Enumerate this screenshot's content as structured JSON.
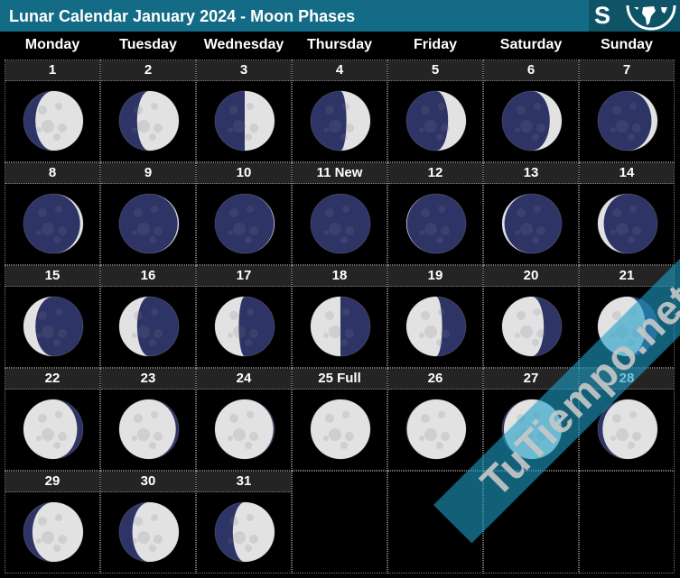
{
  "header": {
    "title": "Lunar Calendar January 2024 - Moon Phases",
    "hemisphere_label": "S",
    "hemisphere_icon": "globe-southern-hemisphere-icon"
  },
  "colors": {
    "header_bg": "#146b85",
    "hemisphere_bg": "#0f5466",
    "day_header_bg": "#242424",
    "moon_lit": "#e2e2e2",
    "moon_dark": "#2e3566",
    "background": "#000000"
  },
  "weekdays": [
    "Monday",
    "Tuesday",
    "Wednesday",
    "Thursday",
    "Friday",
    "Saturday",
    "Sunday"
  ],
  "days": [
    {
      "label": "1",
      "illum": 0.8,
      "lit_side": "right"
    },
    {
      "label": "2",
      "illum": 0.7,
      "lit_side": "right"
    },
    {
      "label": "3",
      "illum": 0.5,
      "lit_side": "right"
    },
    {
      "label": "4",
      "illum": 0.4,
      "lit_side": "right"
    },
    {
      "label": "5",
      "illum": 0.3,
      "lit_side": "right"
    },
    {
      "label": "6",
      "illum": 0.2,
      "lit_side": "right"
    },
    {
      "label": "7",
      "illum": 0.1,
      "lit_side": "right"
    },
    {
      "label": "8",
      "illum": 0.05,
      "lit_side": "right"
    },
    {
      "label": "9",
      "illum": 0.02,
      "lit_side": "right"
    },
    {
      "label": "10",
      "illum": 0.01,
      "lit_side": "right"
    },
    {
      "label": "11 New",
      "illum": 0,
      "lit_side": "left"
    },
    {
      "label": "12",
      "illum": 0.01,
      "lit_side": "left"
    },
    {
      "label": "13",
      "illum": 0.04,
      "lit_side": "left"
    },
    {
      "label": "14",
      "illum": 0.1,
      "lit_side": "left"
    },
    {
      "label": "15",
      "illum": 0.2,
      "lit_side": "left"
    },
    {
      "label": "16",
      "illum": 0.3,
      "lit_side": "left"
    },
    {
      "label": "17",
      "illum": 0.4,
      "lit_side": "left"
    },
    {
      "label": "18",
      "illum": 0.5,
      "lit_side": "left"
    },
    {
      "label": "19",
      "illum": 0.6,
      "lit_side": "left"
    },
    {
      "label": "20",
      "illum": 0.7,
      "lit_side": "left"
    },
    {
      "label": "21",
      "illum": 0.8,
      "lit_side": "left"
    },
    {
      "label": "22",
      "illum": 0.9,
      "lit_side": "left"
    },
    {
      "label": "23",
      "illum": 0.95,
      "lit_side": "left"
    },
    {
      "label": "24",
      "illum": 0.98,
      "lit_side": "left"
    },
    {
      "label": "25 Full",
      "illum": 1,
      "lit_side": "left"
    },
    {
      "label": "26",
      "illum": 0.99,
      "lit_side": "right"
    },
    {
      "label": "27",
      "illum": 0.97,
      "lit_side": "right"
    },
    {
      "label": "28",
      "illum": 0.92,
      "lit_side": "right"
    },
    {
      "label": "29",
      "illum": 0.85,
      "lit_side": "right"
    },
    {
      "label": "30",
      "illum": 0.78,
      "lit_side": "right"
    },
    {
      "label": "31",
      "illum": 0.7,
      "lit_side": "right"
    }
  ],
  "watermark": "TuTiempo.net"
}
